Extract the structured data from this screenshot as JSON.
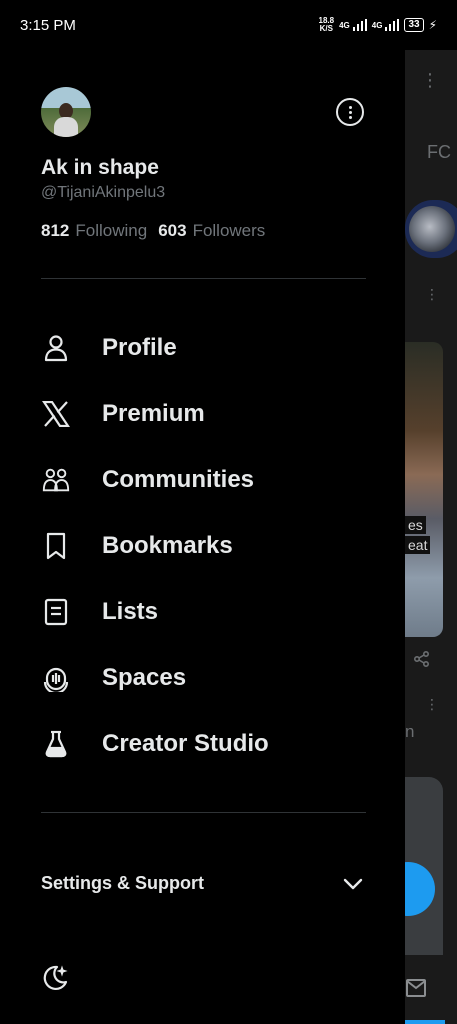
{
  "status_bar": {
    "time": "3:15 PM",
    "net_speed_value": "18.8",
    "net_speed_unit": "K/S",
    "sim1": "4G",
    "sim2": "4G",
    "battery": "33"
  },
  "feed_peek": {
    "tab_fragment": "FC",
    "tag_top": "es",
    "tag_bottom": "eat",
    "text_fragment": "n"
  },
  "profile": {
    "display_name": "Ak in shape",
    "handle": "@TijaniAkinpelu3",
    "following_count": "812",
    "following_label": "Following",
    "followers_count": "603",
    "followers_label": "Followers"
  },
  "menu": [
    {
      "label": "Profile",
      "icon": "person-icon"
    },
    {
      "label": "Premium",
      "icon": "x-logo-icon"
    },
    {
      "label": "Communities",
      "icon": "communities-icon"
    },
    {
      "label": "Bookmarks",
      "icon": "bookmark-icon"
    },
    {
      "label": "Lists",
      "icon": "list-icon"
    },
    {
      "label": "Spaces",
      "icon": "spaces-icon"
    },
    {
      "label": "Creator Studio",
      "icon": "flask-icon"
    }
  ],
  "settings": {
    "label": "Settings & Support",
    "icon": "chevron-down-icon"
  },
  "footer": {
    "icon": "moon-icon"
  },
  "colors": {
    "background": "#000000",
    "text_primary": "#e7e9ea",
    "text_secondary": "#71767b",
    "divider": "#2f3336",
    "accent": "#1d9bf0"
  }
}
